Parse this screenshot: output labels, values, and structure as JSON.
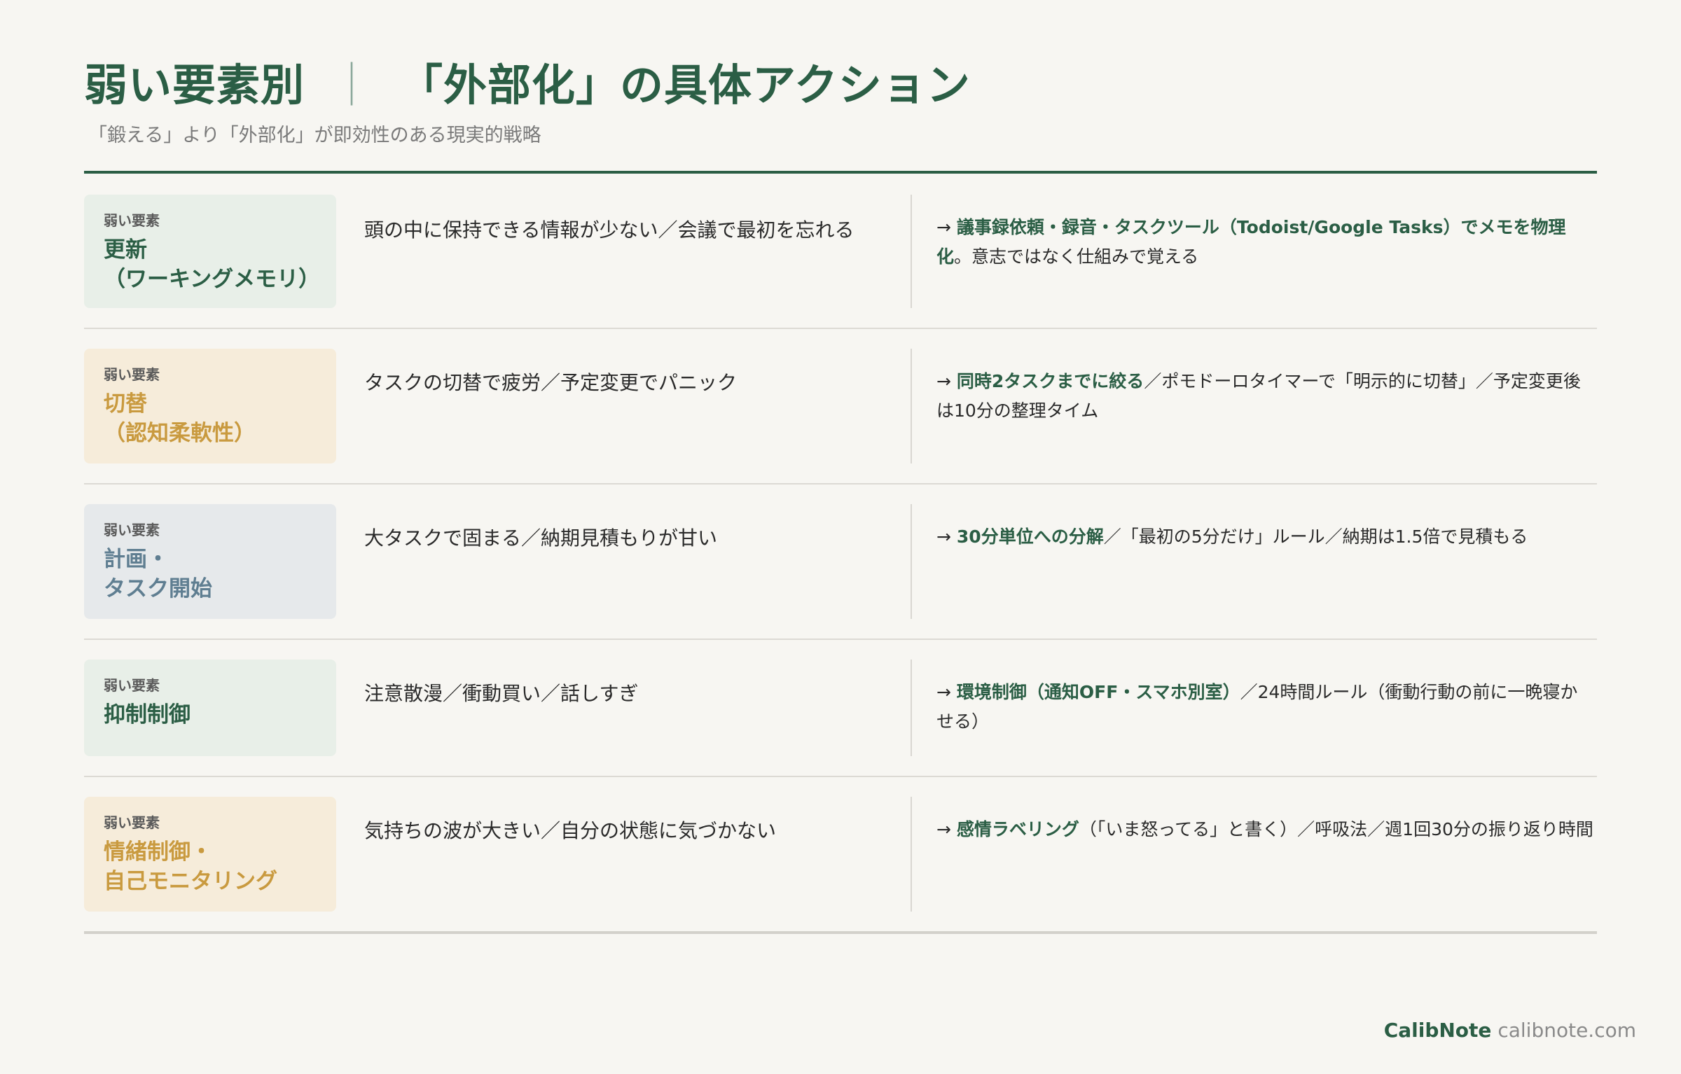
{
  "header": {
    "title_main": "弱い要素別",
    "title_sep": "｜",
    "title_sub": "「外部化」の具体アクション",
    "subtitle": "「鍛える」より「外部化」が即効性のある現実的戦略"
  },
  "rows": [
    {
      "tag_label": "弱い要素",
      "tag_name": "更新\n（ワーキングメモリ）",
      "tag_color": "#2b5e45",
      "symptom": "頭の中に保持できる情報が少ない／会議で最初を忘れる",
      "action_prefix": "→ ",
      "action_highlight": "議事録依頼・録音・タスクツール（Todoist/Google Tasks）でメモを物理化",
      "action_rest": "。意志ではなく仕組みで覚える"
    },
    {
      "tag_label": "弱い要素",
      "tag_name": "切替\n（認知柔軟性）",
      "tag_color": "#c99a3f",
      "symptom": "タスクの切替で疲労／予定変更でパニック",
      "action_prefix": "→ ",
      "action_highlight": "同時2タスクまでに絞る",
      "action_rest": "／ポモドーロタイマーで「明示的に切替」／予定変更後は10分の整理タイム"
    },
    {
      "tag_label": "弱い要素",
      "tag_name": "計画・\nタスク開始",
      "tag_color": "#5f7e91",
      "symptom": "大タスクで固まる／納期見積もりが甘い",
      "action_prefix": "→ ",
      "action_highlight": "30分単位への分解",
      "action_rest": "／「最初の5分だけ」ルール／納期は1.5倍で見積もる"
    },
    {
      "tag_label": "弱い要素",
      "tag_name": "抑制制御",
      "tag_color": "#2b5e45",
      "symptom": "注意散漫／衝動買い／話しすぎ",
      "action_prefix": "→ ",
      "action_highlight": "環境制御（通知OFF・スマホ別室）",
      "action_rest": "／24時間ルール（衝動行動の前に一晩寝かせる）"
    },
    {
      "tag_label": "弱い要素",
      "tag_name": "情緒制御・\n自己モニタリング",
      "tag_color": "#c99a3f",
      "symptom": "気持ちの波が大きい／自分の状態に気づかない",
      "action_prefix": "→ ",
      "action_highlight": "感情ラベリング",
      "action_rest": "（「いま怒ってる」と書く）／呼吸法／週1回30分の振り返り時間"
    }
  ],
  "footer": {
    "brand": "CalibNote",
    "domain": "calibnote.com"
  },
  "colors": {
    "accent": "#2b5e45",
    "yellow": "#c99a3f",
    "gray_blue": "#5f7e91",
    "background": "#f7f6f2"
  }
}
